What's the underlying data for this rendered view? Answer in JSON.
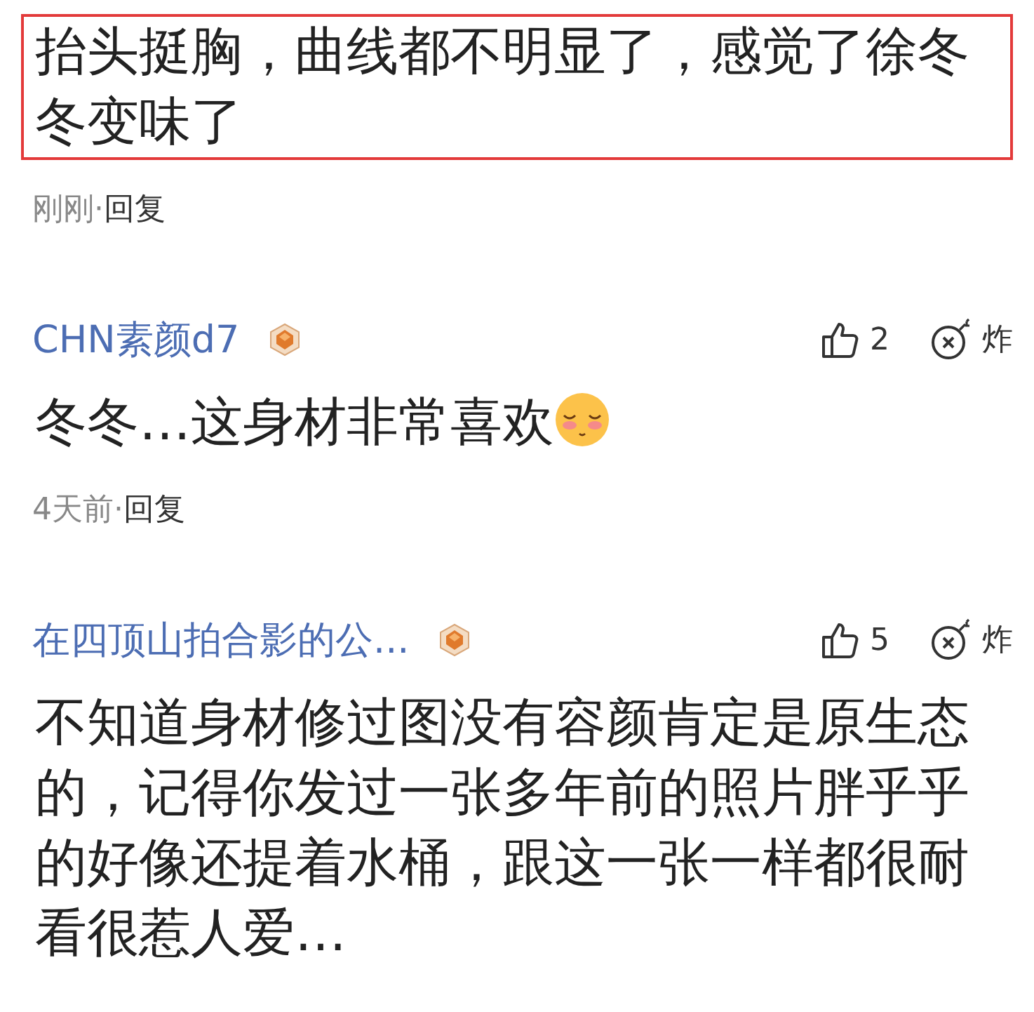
{
  "comments": [
    {
      "highlighted": true,
      "text": "抬头挺胸，曲线都不明显了，感觉了徐冬冬变味了",
      "time": "刚刚",
      "separator": "·",
      "reply": "回复"
    },
    {
      "highlighted": false,
      "author": "CHN素颜d7",
      "badge": true,
      "likes": "2",
      "report": "炸",
      "text": "冬冬…这身材非常喜欢",
      "trailing_emoji": true,
      "time": "4天前",
      "separator": "·",
      "reply": "回复"
    },
    {
      "highlighted": false,
      "author": "在四顶山拍合影的公...",
      "badge": true,
      "likes": "5",
      "report": "炸",
      "text": "不知道身材修过图没有容颜肯定是原生态的，记得你发过一张多年前的照片胖乎乎的好像还提着水桶，跟这一张一样都很耐看很惹人爱…"
    }
  ]
}
